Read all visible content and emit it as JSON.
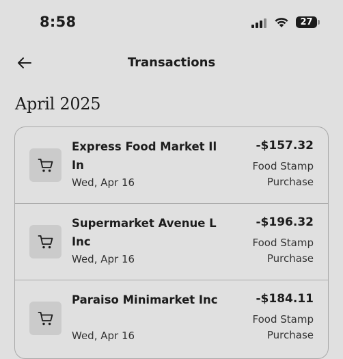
{
  "status_bar": {
    "time": "8:58",
    "battery_level": "27",
    "icons": [
      "signal-icon",
      "wifi-icon",
      "battery-icon"
    ]
  },
  "header": {
    "title": "Transactions",
    "back_icon": "arrow-left-icon"
  },
  "section": {
    "month": "April 2025"
  },
  "transactions": [
    {
      "merchant": "Express Food Market Il In",
      "date": "Wed, Apr 16",
      "amount": "-$157.32",
      "type": "Food Stamp Purchase",
      "icon": "cart-icon"
    },
    {
      "merchant": "Supermarket Avenue L Inc",
      "date": "Wed, Apr 16",
      "amount": "-$196.32",
      "type": "Food Stamp Purchase",
      "icon": "cart-icon"
    },
    {
      "merchant": "Paraiso Minimarket Inc",
      "date": "Wed, Apr 16",
      "amount": "-$184.11",
      "type": "Food Stamp Purchase",
      "icon": "cart-icon"
    }
  ],
  "colors": {
    "background": "#e0e0e0",
    "text": "#1c1c1c",
    "icon_tile": "#cbcbcb",
    "card_border": "#a8a8a8"
  }
}
